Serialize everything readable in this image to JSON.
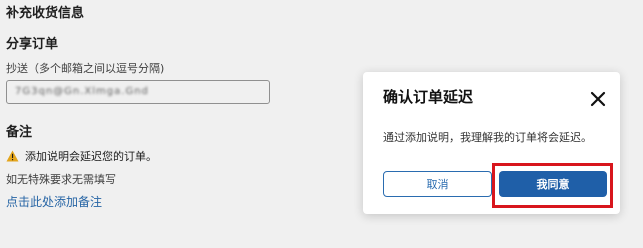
{
  "form": {
    "section_title": "补充收货信息",
    "share_order_title": "分享订单",
    "cc_label": "抄送（多个邮箱之间以逗号分隔)",
    "cc_value": "7G3qn@Gn.Xlmga.Gnd",
    "note_title": "备注",
    "warning_text": "添加说明会延迟您的订单。",
    "hint_text": "如无特殊要求无需填写",
    "add_note_link": "点击此处添加备注"
  },
  "dialog": {
    "title": "确认订单延迟",
    "message": "通过添加说明，我理解我的订单将会延迟。",
    "cancel_label": "取消",
    "agree_label": "我同意"
  },
  "colors": {
    "primary": "#1f5fa8",
    "link": "#2a6cb0",
    "highlight": "#d8161d",
    "warning": "#f2b01e"
  },
  "icons": {
    "warning": "warning-triangle-icon",
    "close": "close-icon"
  }
}
